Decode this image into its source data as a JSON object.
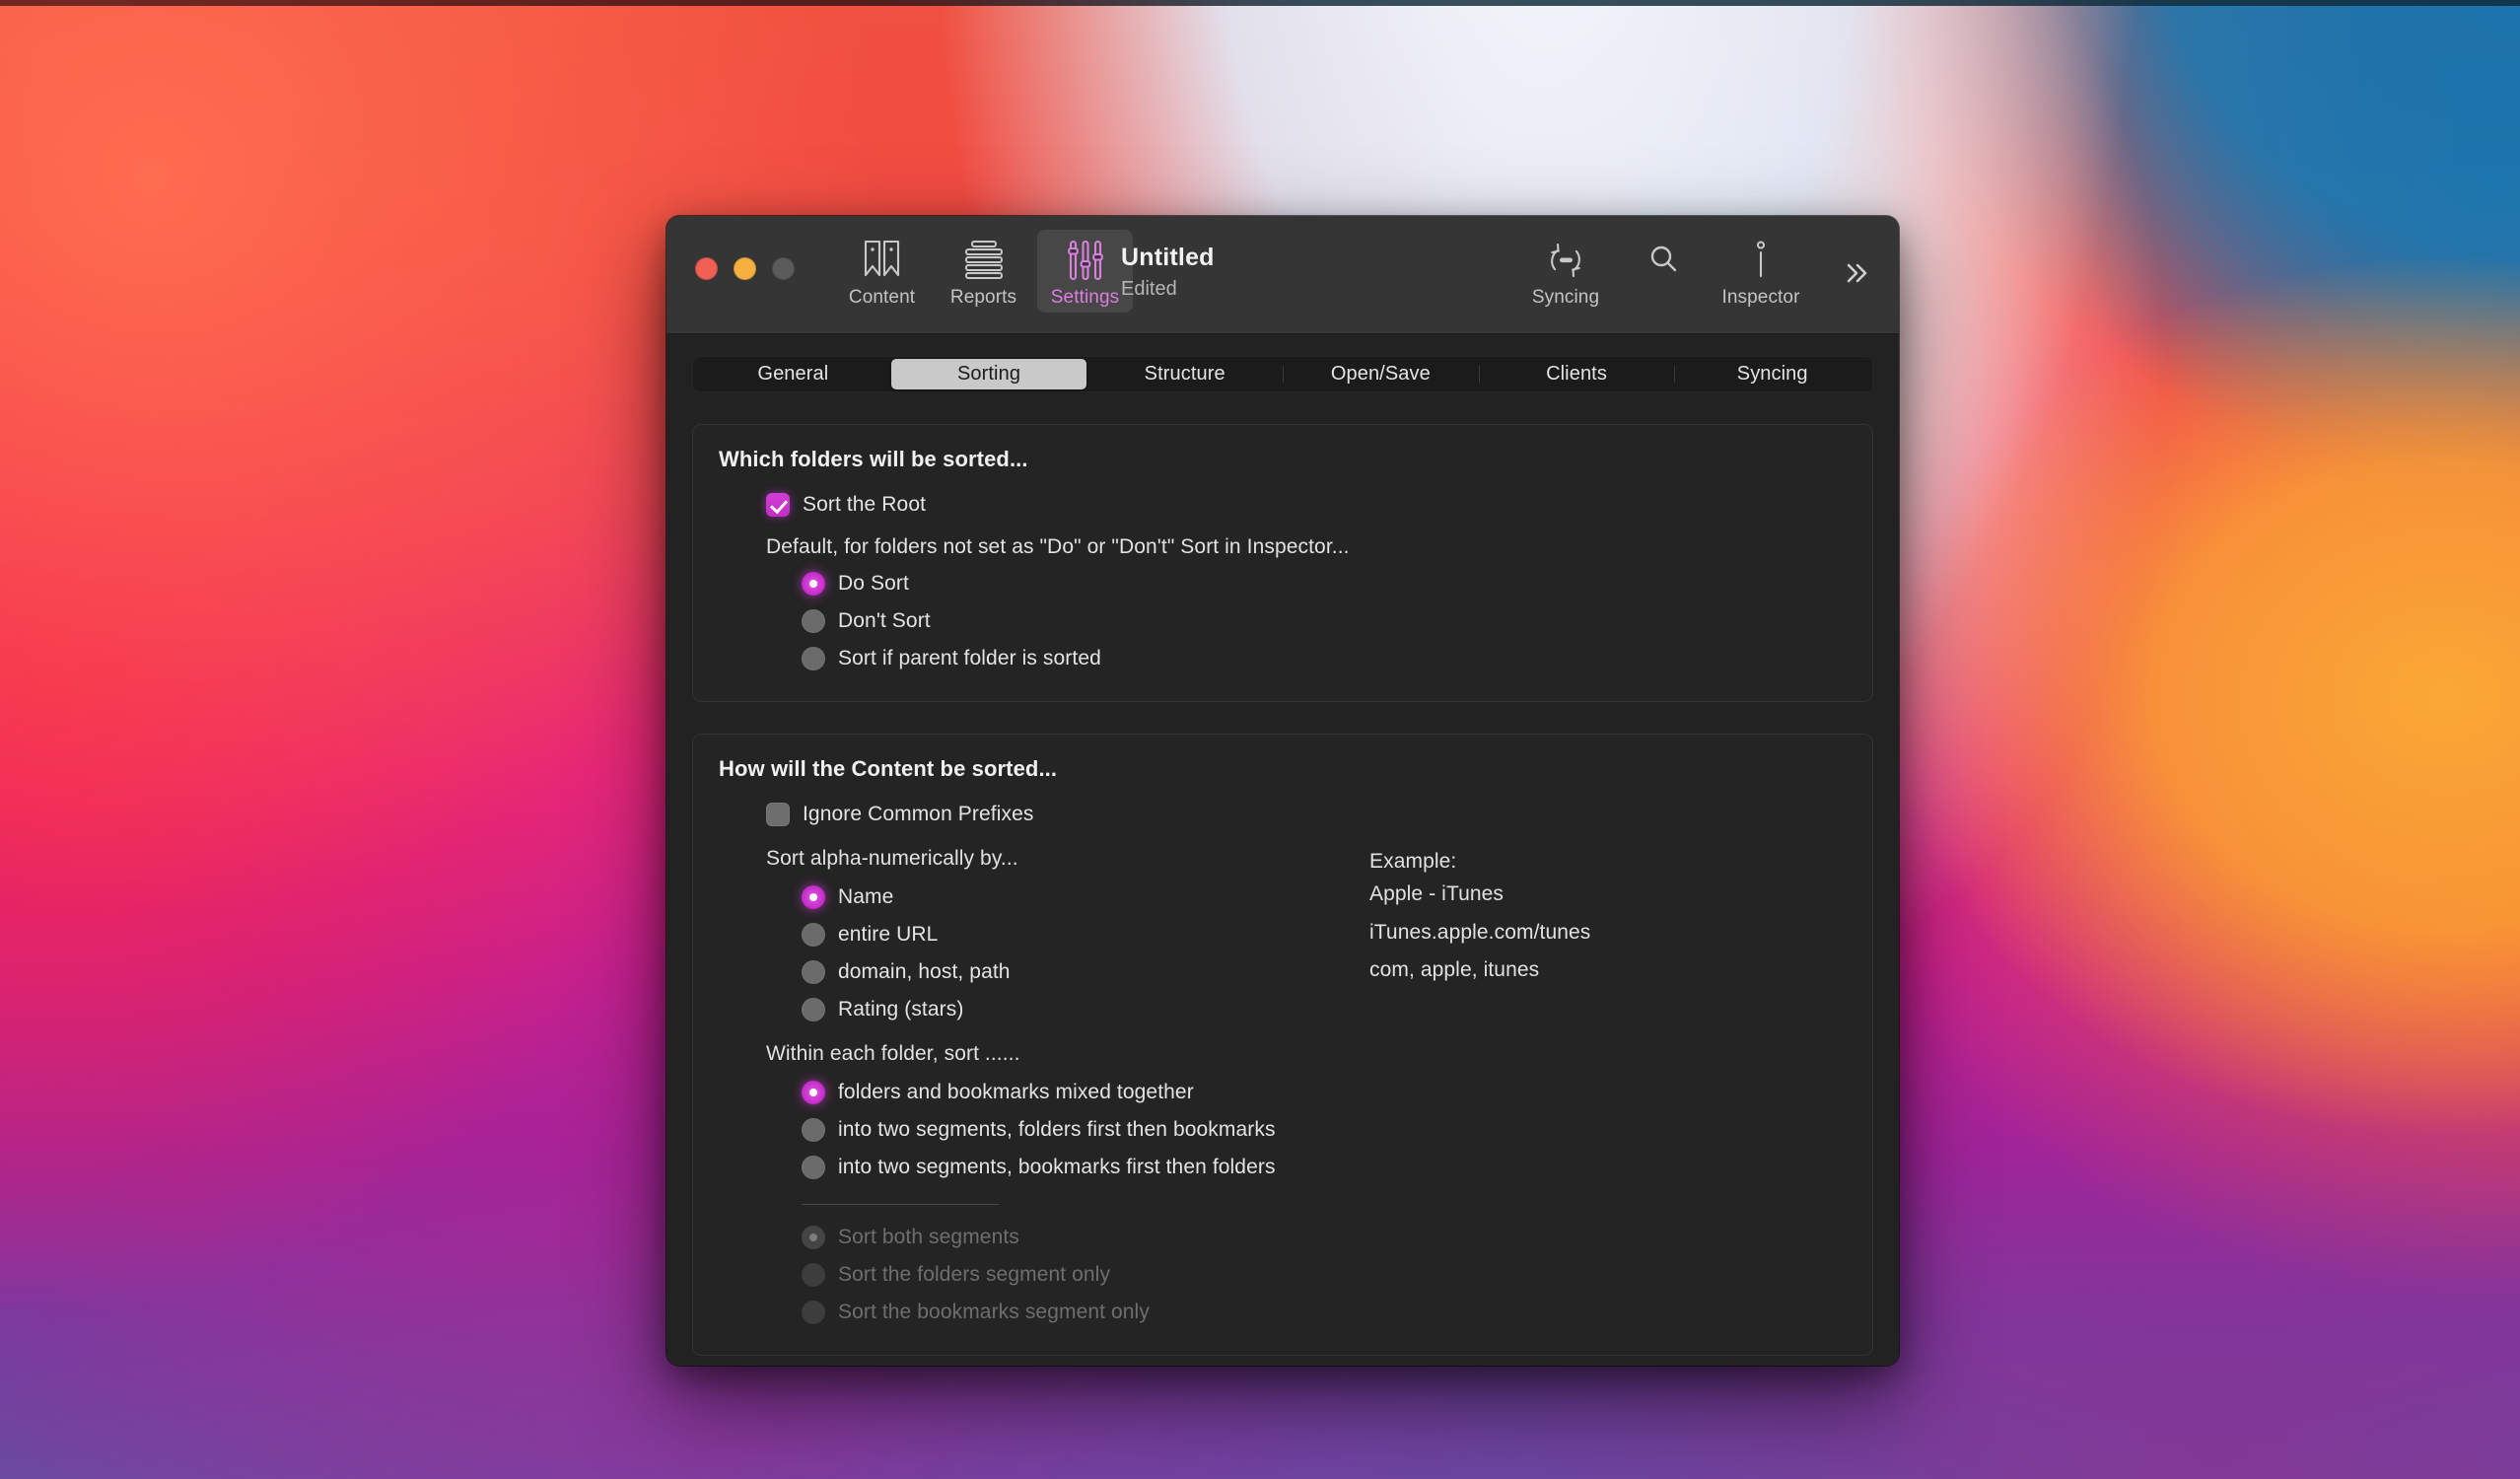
{
  "window": {
    "traffic_lights": [
      "close",
      "minimize",
      "zoom"
    ],
    "document_title": "Untitled",
    "document_state": "Edited"
  },
  "toolbar": {
    "left_items": [
      {
        "label": "Content",
        "icon": "bookmarks-icon",
        "active": false
      },
      {
        "label": "Reports",
        "icon": "report-lines-icon",
        "active": false
      },
      {
        "label": "Settings",
        "icon": "sliders-icon",
        "active": true
      }
    ],
    "right_items": [
      {
        "label": "Syncing",
        "icon": "sync-arrows-icon",
        "active": false
      },
      {
        "label": "",
        "icon": "search-icon",
        "active": false
      },
      {
        "label": "Inspector",
        "icon": "info-icon",
        "active": false
      }
    ],
    "overflow_icon": "double-chevron-right-icon"
  },
  "tabs": [
    {
      "label": "General",
      "selected": false
    },
    {
      "label": "Sorting",
      "selected": true
    },
    {
      "label": "Structure",
      "selected": false
    },
    {
      "label": "Open/Save",
      "selected": false
    },
    {
      "label": "Clients",
      "selected": false
    },
    {
      "label": "Syncing",
      "selected": false
    }
  ],
  "groups": {
    "folders": {
      "title": "Which folders will be sorted...",
      "sort_root": {
        "label": "Sort the Root",
        "checked": true
      },
      "default_note": "Default, for folders not set as \"Do\" or \"Don't\" Sort in Inspector...",
      "options": [
        {
          "label": "Do Sort",
          "selected": true
        },
        {
          "label": "Don't Sort",
          "selected": false
        },
        {
          "label": "Sort if parent folder is sorted",
          "selected": false
        }
      ]
    },
    "content": {
      "title": "How will the Content be sorted...",
      "ignore_prefixes": {
        "label": "Ignore Common Prefixes",
        "checked": false
      },
      "alpha_label": "Sort alpha-numerically by...",
      "alpha_options": [
        {
          "label": "Name",
          "selected": true
        },
        {
          "label": "entire URL",
          "selected": false
        },
        {
          "label": "domain, host, path",
          "selected": false
        },
        {
          "label": "Rating (stars)",
          "selected": false
        }
      ],
      "example_heading": "Example:",
      "examples": [
        "Apple - iTunes",
        "iTunes.apple.com/tunes",
        "com, apple, itunes"
      ],
      "within_label": "Within each folder, sort ......",
      "within_options": [
        {
          "label": "folders and bookmarks mixed together",
          "selected": true
        },
        {
          "label": "into two segments, folders first then bookmarks",
          "selected": false
        },
        {
          "label": "into two segments, bookmarks first then folders",
          "selected": false
        }
      ],
      "segment_options": [
        {
          "label": "Sort both segments",
          "selected": true,
          "disabled": true
        },
        {
          "label": "Sort the folders segment only",
          "selected": false,
          "disabled": true
        },
        {
          "label": "Sort the bookmarks segment only",
          "selected": false,
          "disabled": true
        }
      ]
    }
  },
  "colors": {
    "accent": "#c62ecb",
    "toolbar_bg": "#353535",
    "content_bg": "#222222",
    "tab_selected_bg": "#c9c9c9"
  }
}
